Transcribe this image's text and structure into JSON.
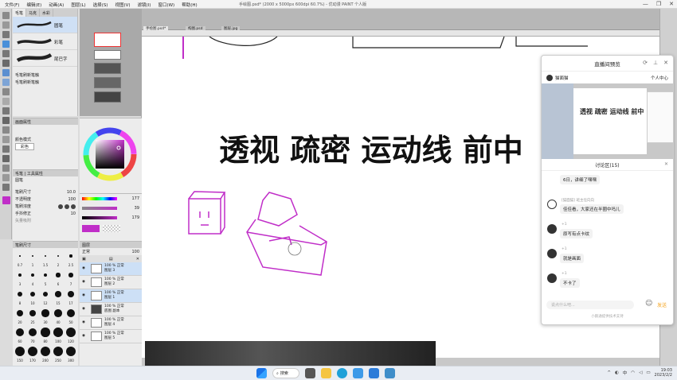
{
  "titlebar": {
    "menu": [
      "文件(F)",
      "编辑(E)",
      "动画(A)",
      "图层(L)",
      "选择(S)",
      "视图(V)",
      "滤镜(I)",
      "窗口(W)",
      "帮助(H)"
    ],
    "doc_title": "手绘图.psd* (2000 x 5000px 600dpi 60.7%) - 优动漫 PAINT 个人版",
    "controls": [
      "—",
      "❐",
      "✕"
    ]
  },
  "subtool": {
    "tabs": [
      "毛笔",
      "马克",
      "水彩"
    ],
    "brushes": [
      "圆笔",
      "彩笔",
      "尾巴字"
    ],
    "lower_label_1": "毛笔刷新笔触",
    "lower_label_2": "毛笔刷新笔触"
  },
  "toolprop": {
    "title": "画面属性",
    "blend_label": "颜色模式",
    "blend_value": "彩色"
  },
  "brushsize": {
    "title": "毛笔 | 工具属性",
    "name": "圆笔",
    "rows": [
      {
        "label": "笔刷尺寸",
        "value": "10.0"
      },
      {
        "label": "不透明度",
        "value": "100"
      },
      {
        "label": "笔刷浓度",
        "value": ""
      },
      {
        "label": "手抖修正",
        "value": "10"
      }
    ],
    "anti_alias": "矢量吸附"
  },
  "colors": {
    "accent": "#c02ec8",
    "fg": "#c02ec8",
    "slider_values": [
      "177",
      "39",
      "179"
    ]
  },
  "dots": {
    "title": "笔刷尺寸",
    "labels": [
      "0.7",
      "1",
      "1.5",
      "2",
      "2.5",
      "3",
      "4",
      "5",
      "6",
      "7",
      "8",
      "10",
      "12",
      "15",
      "17",
      "20",
      "25",
      "30",
      "40",
      "50",
      "60",
      "70",
      "80",
      "100",
      "120",
      "150",
      "170",
      "200",
      "250",
      "300"
    ]
  },
  "layers": {
    "title": "图层",
    "blend": "正常",
    "opacity": "100",
    "items": [
      {
        "pct": "100 %",
        "mode": "正常",
        "name": "图层 3"
      },
      {
        "pct": "100 %",
        "mode": "正常",
        "name": "图层 2"
      },
      {
        "pct": "100 %",
        "mode": "正常",
        "name": "图层 1"
      },
      {
        "pct": "100 %",
        "mode": "正常",
        "name": "底图 副本"
      },
      {
        "pct": "100 %",
        "mode": "正常",
        "name": "图层 4"
      },
      {
        "pct": "100 %",
        "mode": "正常",
        "name": "图层 5"
      }
    ]
  },
  "tabs": [
    "手绘图.psd*",
    "构图.psd",
    "图层.jpg"
  ],
  "canvas": {
    "headline": "透视 疏密 运动线 前中"
  },
  "live": {
    "title": "直播间预览",
    "host": "猫面猫",
    "user_center": "个人中心",
    "preview_text": "透视 疏密 运动线 前中",
    "comments_title": "讨论区(15)",
    "comments": [
      {
        "name": "",
        "text": "6日，讲细了嘿嘿",
        "badge": ""
      },
      {
        "name": "[猫面猫] 班主任向向",
        "text": "佳佳看，大家还在半圈中吗儿",
        "badge": "班主任"
      },
      {
        "name": "+1",
        "text": "原写有点卡纹",
        "badge": ""
      },
      {
        "name": "+1",
        "text": "就是画面",
        "badge": ""
      },
      {
        "name": "+1",
        "text": "不卡了",
        "badge": ""
      }
    ],
    "input_placeholder": "说点什么吧...",
    "send_label": "发送",
    "footer": "小鹅通提供技术支持"
  },
  "float": {
    "label": "中 ♪"
  },
  "taskbar": {
    "search": "搜索",
    "lang": "中",
    "time": "19:03",
    "date": "2023/2/2"
  }
}
